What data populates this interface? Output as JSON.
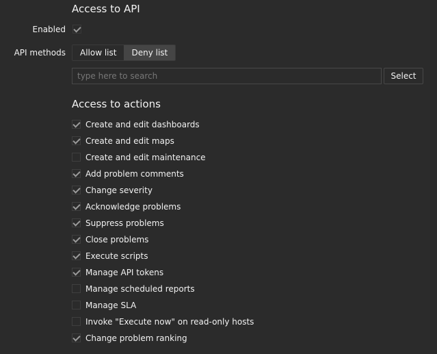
{
  "api_section": {
    "title": "Access to API",
    "enabled_label": "Enabled",
    "enabled_checked": true,
    "methods_label": "API methods",
    "methods_options": [
      "Allow list",
      "Deny list"
    ],
    "methods_selected": "Deny list",
    "search_placeholder": "type here to search",
    "select_label": "Select"
  },
  "actions_section": {
    "title": "Access to actions",
    "items": [
      {
        "label": "Create and edit dashboards",
        "checked": true
      },
      {
        "label": "Create and edit maps",
        "checked": true
      },
      {
        "label": "Create and edit maintenance",
        "checked": false
      },
      {
        "label": "Add problem comments",
        "checked": true
      },
      {
        "label": "Change severity",
        "checked": true
      },
      {
        "label": "Acknowledge problems",
        "checked": true
      },
      {
        "label": "Suppress problems",
        "checked": true
      },
      {
        "label": "Close problems",
        "checked": true
      },
      {
        "label": "Execute scripts",
        "checked": true
      },
      {
        "label": "Manage API tokens",
        "checked": true
      },
      {
        "label": "Manage scheduled reports",
        "checked": false
      },
      {
        "label": "Manage SLA",
        "checked": false
      },
      {
        "label": "Invoke \"Execute now\" on read-only hosts",
        "checked": false
      },
      {
        "label": "Change problem ranking",
        "checked": true
      }
    ]
  },
  "colors": {
    "background": "#2b2b2b",
    "text": "#f2f2f2",
    "active_segment": "#454545",
    "check_mark": "#9a9a9a"
  }
}
